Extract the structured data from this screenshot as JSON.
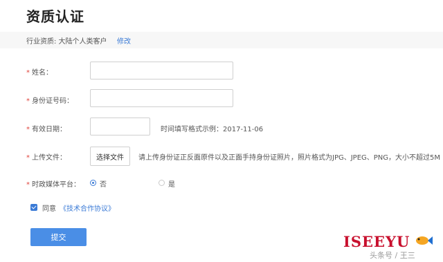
{
  "page": {
    "title": "资质认证"
  },
  "industry": {
    "label": "行业资质: 大陆个人类客户",
    "modify_label": "修改"
  },
  "form": {
    "required_mark": "*",
    "name_label": "姓名：",
    "id_number_label": "身份证号码：",
    "valid_date_label": "有效日期：",
    "valid_date_hint": "时间填写格式示例：2017-11-06",
    "upload_label": "上传文件：",
    "choose_file_label": "选择文件",
    "upload_hint": "请上传身份证正反面原件以及正面手持身份证照片，照片格式为JPG、JPEG、PNG，大小不超过5M",
    "media_platform_label": "时政媒体平台：",
    "media_options": [
      {
        "label": "否",
        "checked": true
      },
      {
        "label": "是",
        "checked": false
      }
    ]
  },
  "agreement": {
    "checked": true,
    "agree_text": "同意",
    "link_text": "《技术合作协议》"
  },
  "submit": {
    "label": "提交"
  },
  "watermark": {
    "main": "ISEEYU",
    "sub": "头条号 / 王三"
  },
  "colors": {
    "accent": "#3b7bd6",
    "button": "#4a8ee6",
    "required": "#e0443c",
    "watermark": "#c8102e"
  }
}
